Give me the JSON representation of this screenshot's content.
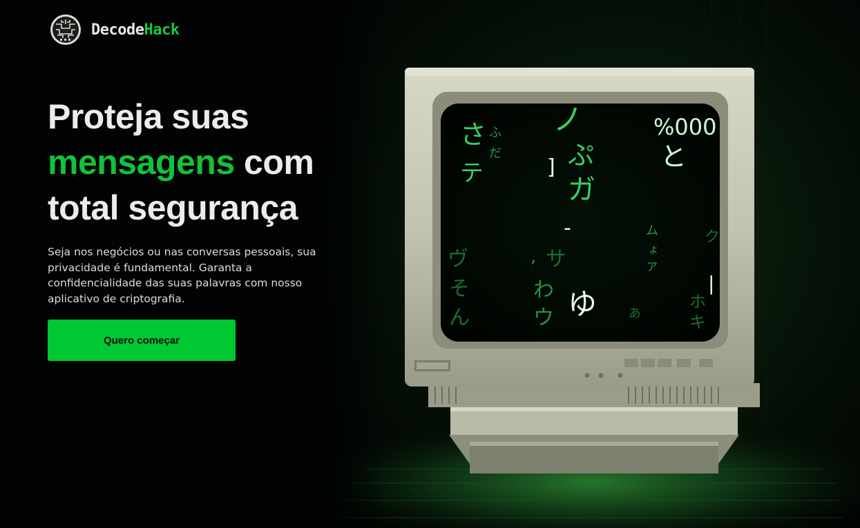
{
  "brand": {
    "name_part1": "Decode",
    "name_part2": "Hack",
    "logo_icon": "circuit-brain-icon"
  },
  "hero": {
    "headline_line1": "Proteja suas",
    "headline_highlight": "mensagens",
    "headline_after_highlight": " com",
    "headline_line3": "total segurança",
    "lead": "Seja nos negócios ou nas conversas pessoais, sua privacidade é fundamental. Garanta a confidencialidade das suas palavras com nosso aplicativo de criptografia.",
    "cta_label": "Quero começar",
    "image_alt": "retro-crt-monitor-matrix-code"
  },
  "colors": {
    "background": "#010402",
    "accent_green": "#12c23a",
    "button_green": "#00c832",
    "text_light": "#ececec"
  }
}
